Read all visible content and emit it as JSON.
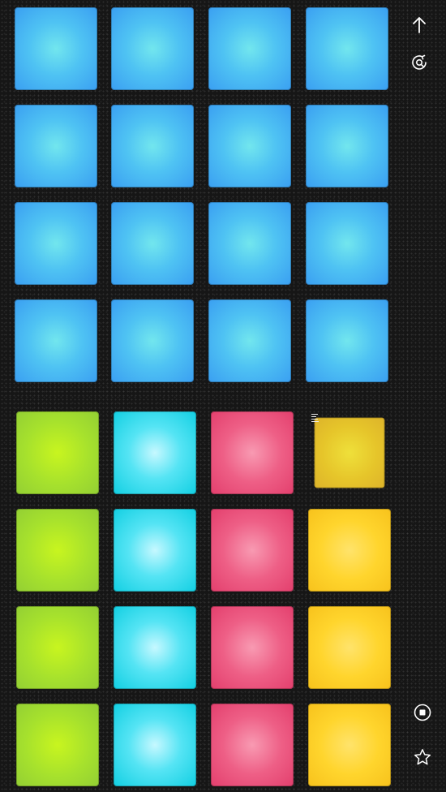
{
  "colors": {
    "background": "#161616",
    "blue": "#4fc3f3",
    "green": "#a6e12d",
    "cyan": "#55e4f4",
    "pink": "#ee5f86",
    "yellow": "#ffd52d",
    "icon": "#ffffff"
  },
  "top_bank": {
    "rows": [
      [
        "blue",
        "blue",
        "blue",
        "blue"
      ],
      [
        "blue",
        "blue",
        "blue",
        "blue"
      ],
      [
        "blue",
        "blue",
        "blue",
        "blue"
      ],
      [
        "blue",
        "blue",
        "blue",
        "blue"
      ]
    ]
  },
  "bottom_bank": {
    "rows": [
      [
        "green",
        "cyan",
        "pink",
        "yellow"
      ],
      [
        "green",
        "cyan",
        "pink",
        "yellow"
      ],
      [
        "green",
        "cyan",
        "pink",
        "yellow"
      ],
      [
        "green",
        "cyan",
        "pink",
        "yellow"
      ]
    ],
    "pressed_pad": {
      "row": 0,
      "col": 3
    }
  },
  "sidebar": {
    "top_icons": [
      "arrow-up-icon",
      "loop-record-icon"
    ],
    "bottom_icons": [
      "stop-icon",
      "star-icon"
    ]
  }
}
